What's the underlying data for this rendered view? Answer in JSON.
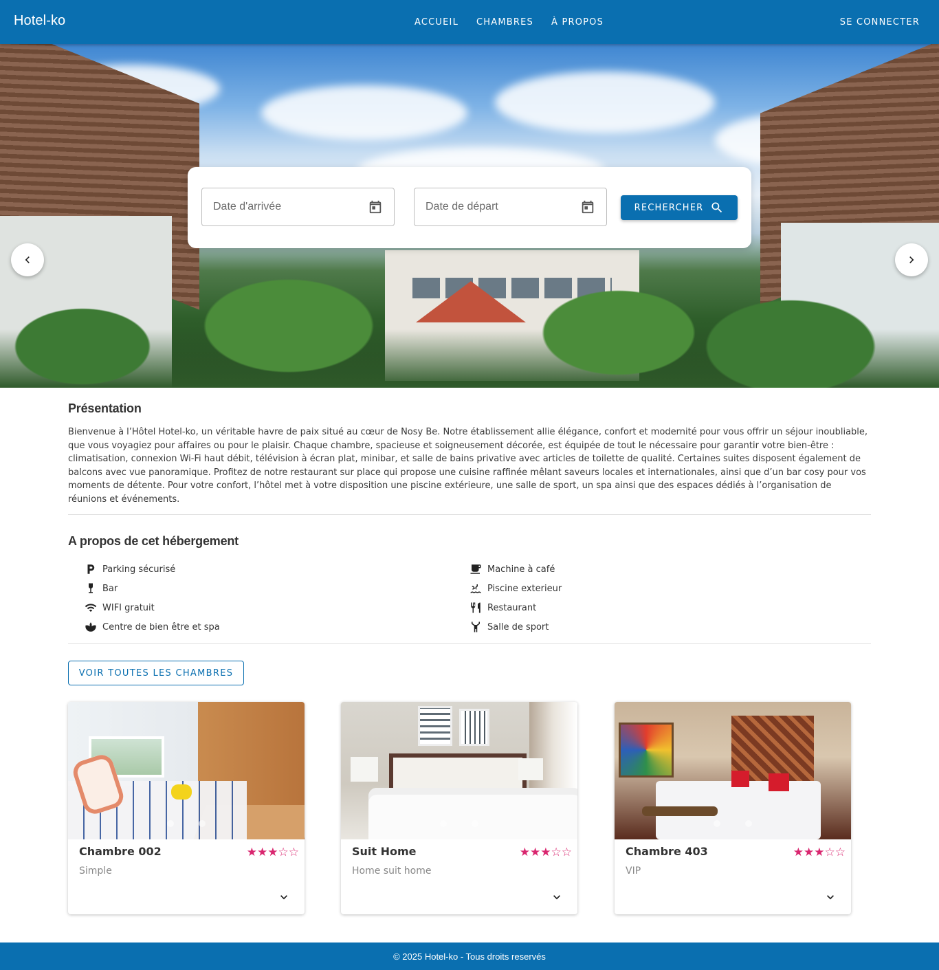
{
  "app": {
    "brand": "Hotel-ko",
    "brand_color": "#0a6fb0"
  },
  "nav": {
    "items": [
      "ACCUEIL",
      "CHAMBRES",
      "À PROPOS"
    ],
    "login": "SE CONNECTER"
  },
  "hero": {
    "prev_icon": "chevron-left-icon",
    "next_icon": "chevron-right-icon",
    "search": {
      "arrival_placeholder": "Date d'arrivée",
      "departure_placeholder": "Date de départ",
      "button_label": "RECHERCHER",
      "calendar_icon": "calendar-icon",
      "search_icon": "search-icon"
    }
  },
  "presentation": {
    "title": "Présentation",
    "text": "Bienvenue à l’Hôtel Hotel-ko, un véritable havre de paix situé au cœur de Nosy Be. Notre établissement allie élégance, confort et modernité pour vous offrir un séjour inoubliable, que vous voyagiez pour affaires ou pour le plaisir. Chaque chambre, spacieuse et soigneusement décorée, est équipée de tout le nécessaire pour garantir votre bien-être : climatisation, connexion Wi-Fi haut débit, télévision à écran plat, minibar, et salle de bains privative avec articles de toilette de qualité. Certaines suites disposent également de balcons avec vue panoramique. Profitez de notre restaurant sur place qui propose une cuisine raffinée mêlant saveurs locales et internationales, ainsi que d’un bar cosy pour vos moments de détente. Pour votre confort, l’hôtel met à votre disposition une piscine extérieure, une salle de sport, un spa ainsi que des espaces dédiés à l’organisation de réunions et événements."
  },
  "about": {
    "title": "A propos de cet hébergement",
    "amenities": [
      {
        "label": "Parking sécurisé",
        "icon": "parking-icon"
      },
      {
        "label": "Bar",
        "icon": "wine-glass-icon"
      },
      {
        "label": "WIFI gratuit",
        "icon": "wifi-icon"
      },
      {
        "label": "Centre de bien être et spa",
        "icon": "spa-icon"
      },
      {
        "label": "Machine à café",
        "icon": "coffee-icon"
      },
      {
        "label": "Piscine exterieur",
        "icon": "pool-icon"
      },
      {
        "label": "Restaurant",
        "icon": "restaurant-icon"
      },
      {
        "label": "Salle de sport",
        "icon": "fitness-icon"
      }
    ]
  },
  "rooms": {
    "all_button": "VOIR TOUTES LES CHAMBRES",
    "star_color": "#d9266f",
    "cards": [
      {
        "name": "Chambre 002",
        "type": "Simple",
        "rating": 3,
        "max_rating": 5
      },
      {
        "name": "Suit Home",
        "type": "Home suit home",
        "rating": 3,
        "max_rating": 5
      },
      {
        "name": "Chambre 403",
        "type": "VIP",
        "rating": 3,
        "max_rating": 5
      }
    ],
    "expand_icon": "chevron-down-icon"
  },
  "footer": {
    "text": "© 2025 Hotel-ko - Tous droits reservés"
  }
}
